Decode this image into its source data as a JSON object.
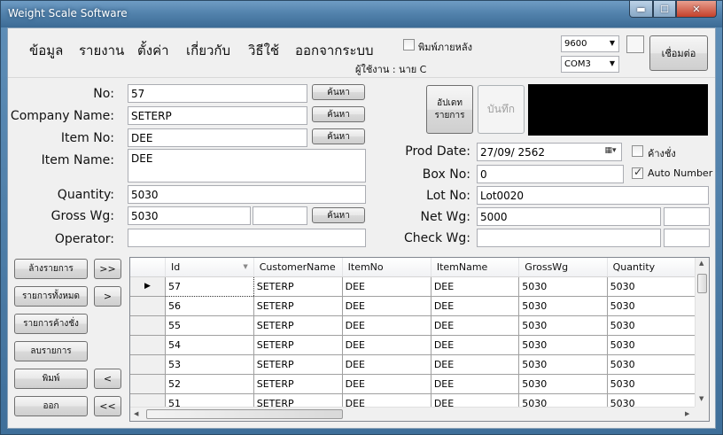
{
  "window": {
    "title": "Weight Scale Software",
    "min_label": "▬",
    "max_label": "☐",
    "close_label": "✕"
  },
  "menu": {
    "items": [
      "ข้อมูล",
      "รายงาน",
      "ตั้งค่า",
      "เกี่ยวกับ",
      "วิธีใช้",
      "ออกจากระบบ"
    ],
    "print_after_label": "พิมพ์ภายหลัง",
    "user_label": "ผู้ใช้งาน : นาย C",
    "baud_value": "9600",
    "port_value": "COM3",
    "connect_label": "เชื่อมต่อ"
  },
  "form": {
    "no_label": "No:",
    "no_value": "57",
    "company_label": "Company Name:",
    "company_value": "SETERP",
    "item_no_label": "Item No:",
    "item_no_value": "DEE",
    "item_name_label": "Item Name:",
    "item_name_value": "DEE",
    "quantity_label": "Quantity:",
    "quantity_value": "5030",
    "gross_label": "Gross Wg:",
    "gross_value": "5030",
    "gross_extra_value": "",
    "operator_label": "Operator:",
    "operator_value": "",
    "search_label": "ค้นหา",
    "update_label": "อัปเดท\nรายการ",
    "save_label": "บันทึก",
    "prod_date_label": "Prod Date:",
    "prod_date_value": "27/09/  2562",
    "pending_label": "ค้างชั่ง",
    "box_no_label": "Box No:",
    "box_no_value": "0",
    "auto_number_label": "Auto Number",
    "lot_no_label": "Lot No:",
    "lot_no_value": "Lot0020",
    "net_label": "Net Wg:",
    "net_value": "5000",
    "net_extra_value": "",
    "check_label": "Check Wg:",
    "check_value": "",
    "check_extra_value": ""
  },
  "actions": {
    "clear_label": "ล้างรายการ",
    "all_label": "รายการทั้งหมด",
    "pending_list_label": "รายการค้างชั่ง",
    "delete_label": "ลบรายการ",
    "print_label": "พิมพ์",
    "exit_label": "ออก",
    "last_label": ">>",
    "next_label": ">",
    "prev_label": "<",
    "first_label": "<<"
  },
  "grid": {
    "columns": [
      "Id",
      "CustomerName",
      "ItemNo",
      "ItemName",
      "GrossWg",
      "Quantity"
    ],
    "rows": [
      [
        "57",
        "SETERP",
        "DEE",
        "DEE",
        "5030",
        "5030"
      ],
      [
        "56",
        "SETERP",
        "DEE",
        "DEE",
        "5030",
        "5030"
      ],
      [
        "55",
        "SETERP",
        "DEE",
        "DEE",
        "5030",
        "5030"
      ],
      [
        "54",
        "SETERP",
        "DEE",
        "DEE",
        "5030",
        "5030"
      ],
      [
        "53",
        "SETERP",
        "DEE",
        "DEE",
        "5030",
        "5030"
      ],
      [
        "52",
        "SETERP",
        "DEE",
        "DEE",
        "5030",
        "5030"
      ],
      [
        "51",
        "SETERP",
        "DEE",
        "DEE",
        "5030",
        "5030"
      ]
    ],
    "current_row_marker": "▶"
  },
  "colors": {
    "titlebar": "#5383ad",
    "client_bg": "#f0f0f0",
    "display_panel": "#000000"
  }
}
